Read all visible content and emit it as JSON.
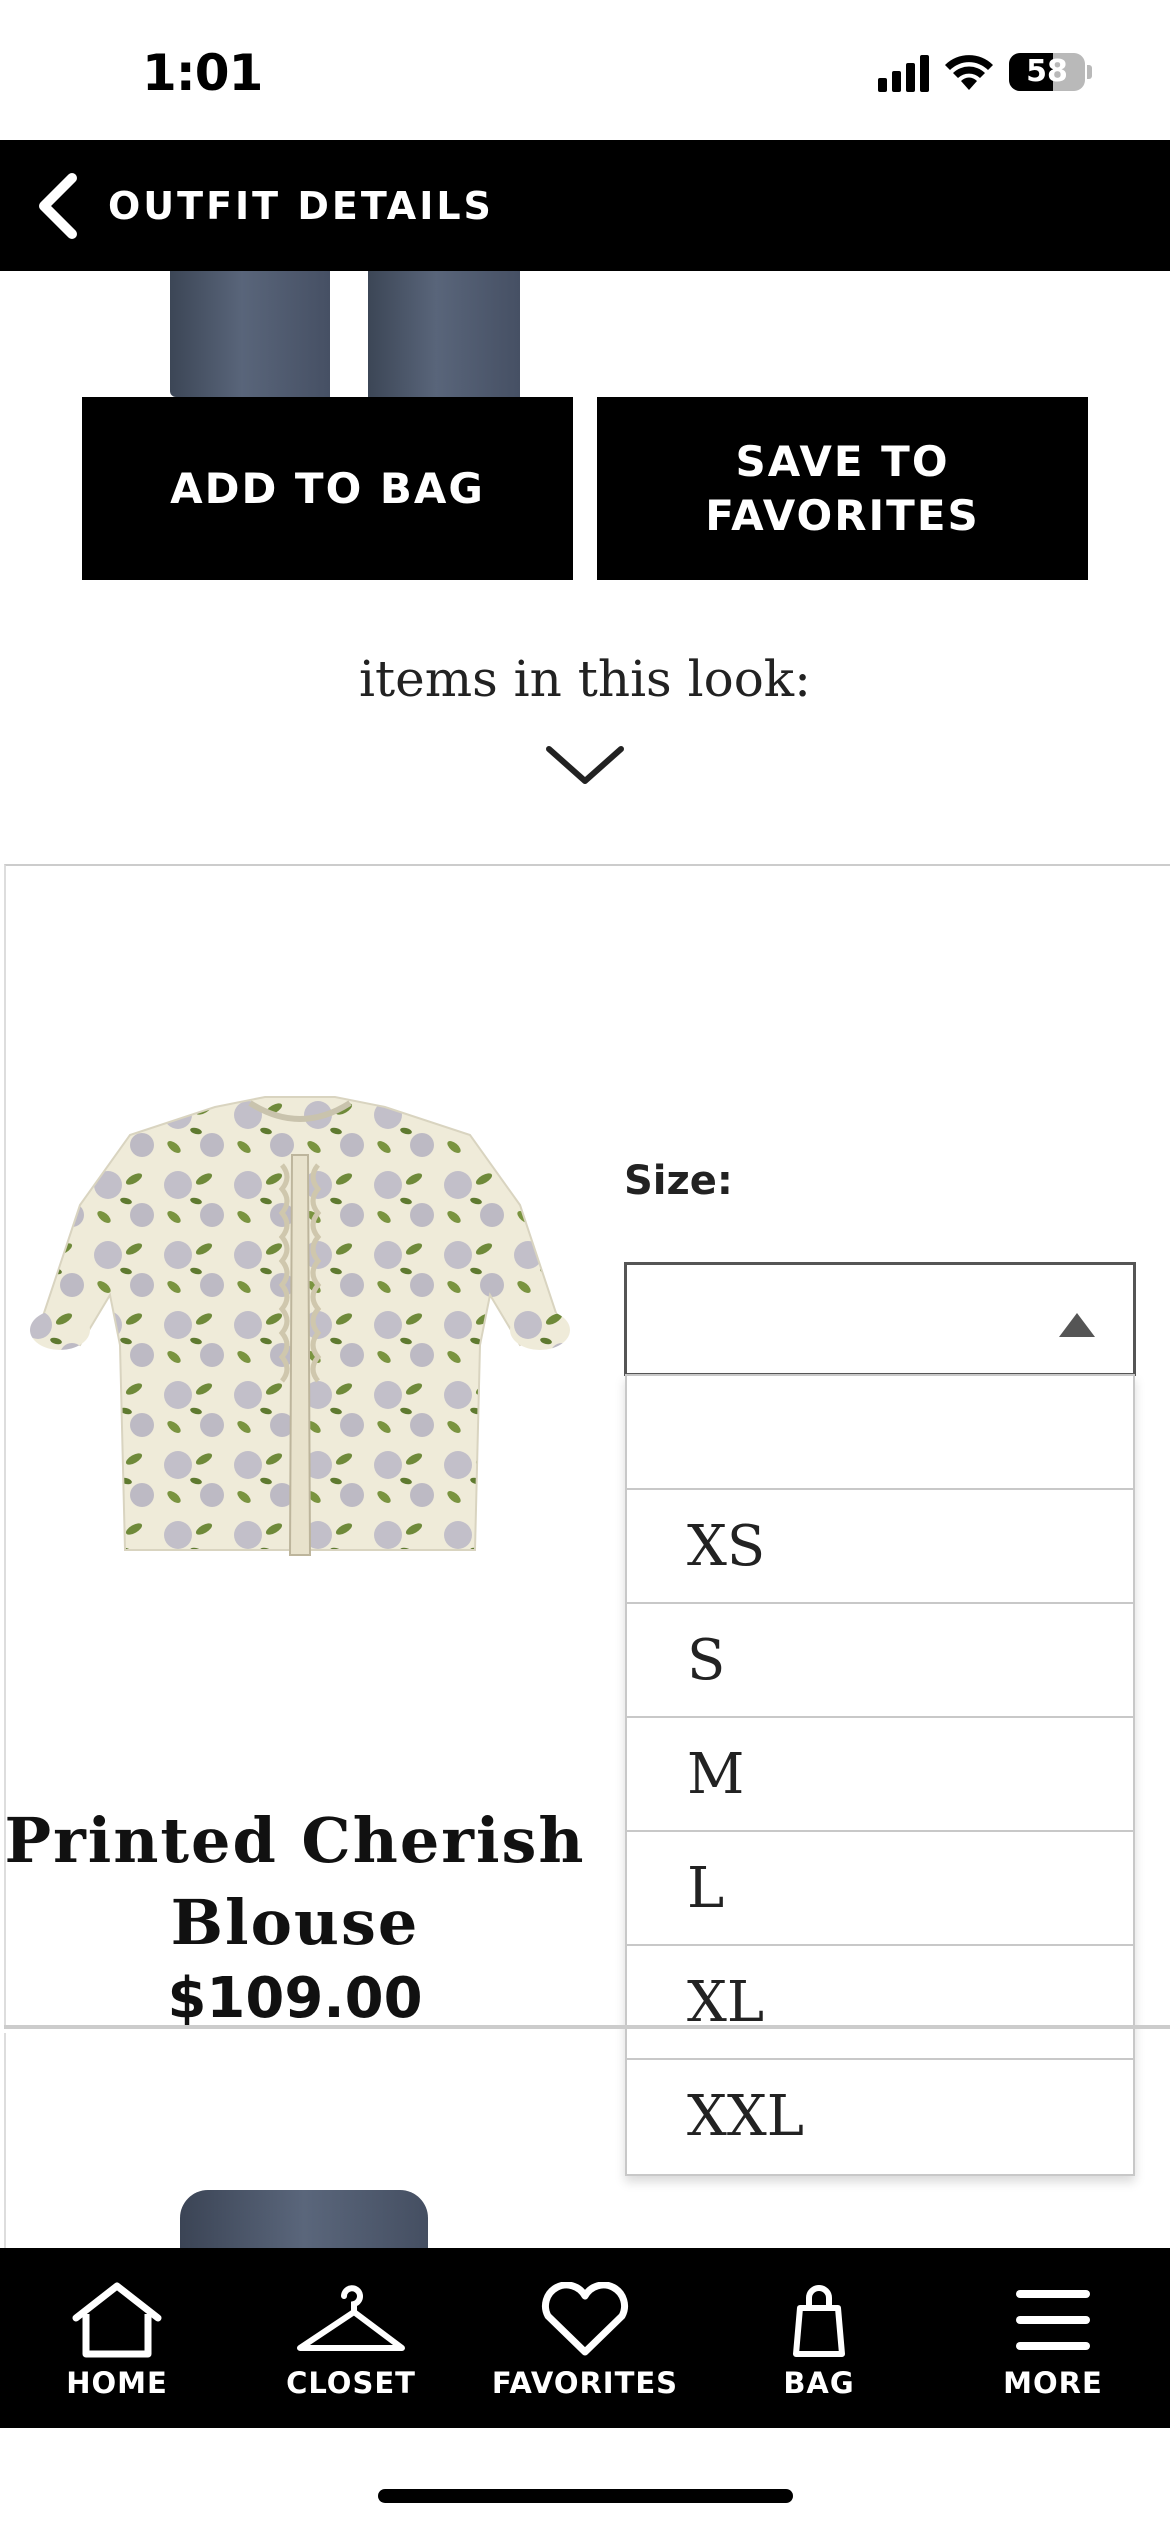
{
  "status_bar": {
    "time": "1:01",
    "battery": "58",
    "battery_level": 0.58
  },
  "header": {
    "title": "OUTFIT DETAILS"
  },
  "actions": {
    "add_to_bag": "ADD TO BAG",
    "save_to_favorites": "SAVE TO\nFAVORITES"
  },
  "look": {
    "label": "items in this look:"
  },
  "product": {
    "name": "Printed Cherish Blouse",
    "price": "$109.00",
    "size_label": "Size:",
    "size_selected": "",
    "size_options": [
      "",
      "XS",
      "S",
      "M",
      "L",
      "XL",
      "XXL"
    ]
  },
  "tabs": [
    {
      "label": "HOME",
      "icon": "home-icon"
    },
    {
      "label": "CLOSET",
      "icon": "hanger-icon"
    },
    {
      "label": "FAVORITES",
      "icon": "heart-icon"
    },
    {
      "label": "BAG",
      "icon": "bag-icon"
    },
    {
      "label": "MORE",
      "icon": "menu-icon"
    }
  ]
}
